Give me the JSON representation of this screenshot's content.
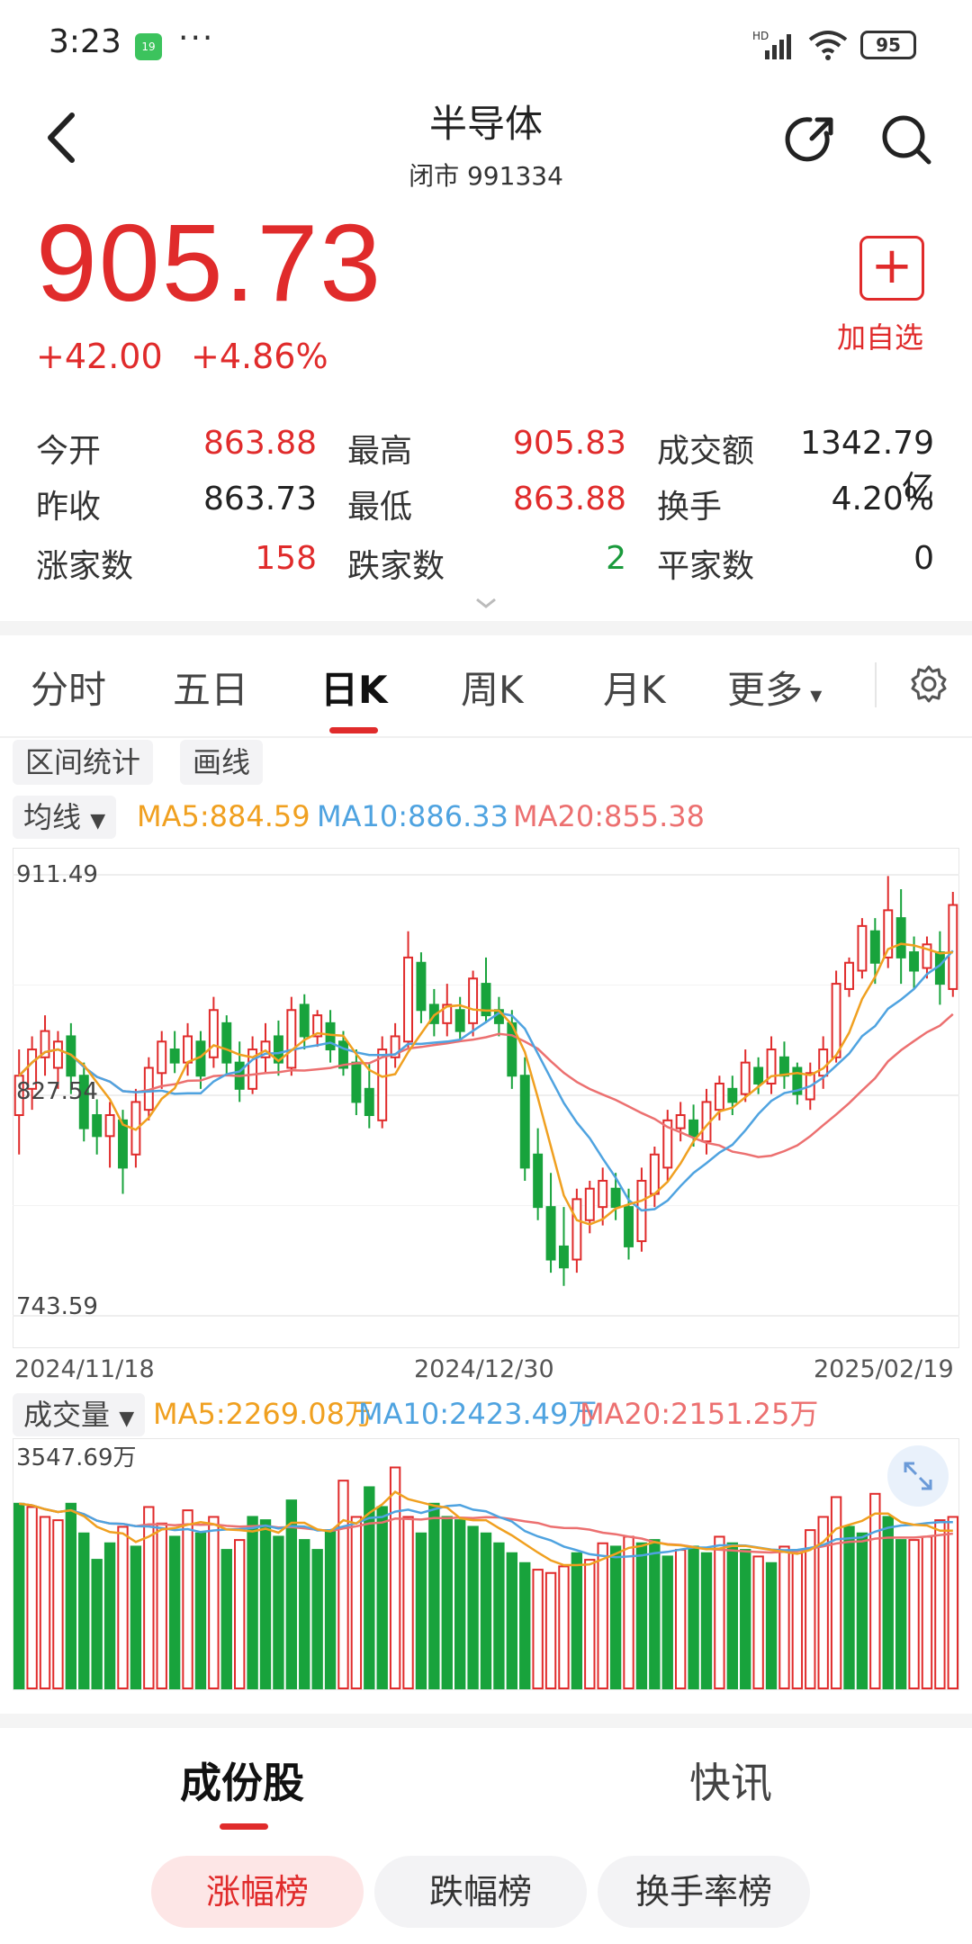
{
  "status_bar": {
    "time": "3:23",
    "badge": "19",
    "dots": "···",
    "battery": "95"
  },
  "header": {
    "title": "半导体",
    "subtitle": "闭市 991334"
  },
  "quote": {
    "price": "905.73",
    "change": "+42.00",
    "change_pct": "+4.86%",
    "add_watch": "加自选"
  },
  "stats": [
    {
      "label": "今开",
      "value": "863.88",
      "color": "red"
    },
    {
      "label": "最高",
      "value": "905.83",
      "color": "red"
    },
    {
      "label": "成交额",
      "value": "1342.79亿",
      "color": "black"
    },
    {
      "label": "昨收",
      "value": "863.73",
      "color": "black"
    },
    {
      "label": "最低",
      "value": "863.88",
      "color": "red"
    },
    {
      "label": "换手",
      "value": "4.20%",
      "color": "black"
    },
    {
      "label": "涨家数",
      "value": "158",
      "color": "red"
    },
    {
      "label": "跌家数",
      "value": "2",
      "color": "green"
    },
    {
      "label": "平家数",
      "value": "0",
      "color": "black"
    }
  ],
  "tabs": [
    "分时",
    "五日",
    "日K",
    "周K",
    "月K",
    "更多"
  ],
  "chips": [
    "区间统计",
    "画线"
  ],
  "ma": {
    "selector": "均线",
    "ma5": "MA5:884.59",
    "ma10": "MA10:886.33",
    "ma20": "MA20:855.38"
  },
  "vol": {
    "selector": "成交量",
    "ma5": "MA5:2269.08万",
    "ma10": "MA10:2423.49万",
    "ma20": "MA20:2151.25万",
    "max_label": "3547.69万"
  },
  "chart_data": {
    "type": "candlestick",
    "y_ticks": [
      "911.49",
      "827.54",
      "743.59"
    ],
    "ylim": [
      743.59,
      911.49
    ],
    "x_labels": [
      "2024/11/18",
      "2024/12/30",
      "2025/02/19"
    ],
    "colors": {
      "up": "#e02b2b",
      "down": "#18a33c",
      "ma5": "#f0a020",
      "ma10": "#4fa3e0",
      "ma20": "#ec7070"
    },
    "candles": [
      [
        820,
        835,
        805,
        845
      ],
      [
        830,
        845,
        822,
        850
      ],
      [
        842,
        852,
        835,
        858
      ],
      [
        838,
        848,
        830,
        852
      ],
      [
        850,
        835,
        828,
        855
      ],
      [
        835,
        815,
        810,
        840
      ],
      [
        820,
        812,
        805,
        826
      ],
      [
        812,
        820,
        800,
        825
      ],
      [
        818,
        800,
        790,
        822
      ],
      [
        805,
        825,
        800,
        830
      ],
      [
        822,
        838,
        818,
        842
      ],
      [
        836,
        848,
        830,
        852
      ],
      [
        845,
        840,
        836,
        852
      ],
      [
        840,
        850,
        835,
        855
      ],
      [
        848,
        835,
        830,
        852
      ],
      [
        842,
        860,
        838,
        865
      ],
      [
        855,
        840,
        835,
        858
      ],
      [
        840,
        830,
        825,
        848
      ],
      [
        830,
        845,
        828,
        850
      ],
      [
        842,
        848,
        836,
        855
      ],
      [
        850,
        840,
        835,
        856
      ],
      [
        838,
        860,
        835,
        865
      ],
      [
        862,
        850,
        845,
        866
      ],
      [
        850,
        858,
        846,
        860
      ],
      [
        855,
        845,
        840,
        860
      ],
      [
        848,
        838,
        835,
        852
      ],
      [
        840,
        825,
        820,
        845
      ],
      [
        830,
        820,
        815,
        840
      ],
      [
        818,
        845,
        815,
        850
      ],
      [
        842,
        850,
        838,
        855
      ],
      [
        848,
        880,
        845,
        890
      ],
      [
        878,
        860,
        855,
        882
      ],
      [
        862,
        855,
        850,
        868
      ],
      [
        855,
        862,
        850,
        870
      ],
      [
        860,
        852,
        848,
        865
      ],
      [
        855,
        872,
        850,
        875
      ],
      [
        870,
        858,
        855,
        880
      ],
      [
        860,
        855,
        850,
        865
      ],
      [
        855,
        835,
        830,
        860
      ],
      [
        835,
        800,
        795,
        842
      ],
      [
        805,
        785,
        780,
        815
      ],
      [
        785,
        765,
        760,
        798
      ],
      [
        770,
        762,
        755,
        785
      ],
      [
        765,
        788,
        760,
        792
      ],
      [
        780,
        792,
        775,
        795
      ],
      [
        785,
        795,
        778,
        800
      ],
      [
        792,
        785,
        780,
        798
      ],
      [
        785,
        770,
        765,
        792
      ],
      [
        772,
        795,
        768,
        800
      ],
      [
        790,
        805,
        785,
        808
      ],
      [
        800,
        818,
        795,
        822
      ],
      [
        815,
        820,
        810,
        825
      ],
      [
        818,
        812,
        808,
        824
      ],
      [
        810,
        825,
        805,
        830
      ],
      [
        822,
        832,
        818,
        835
      ],
      [
        830,
        825,
        820,
        835
      ],
      [
        828,
        840,
        825,
        845
      ],
      [
        838,
        832,
        828,
        842
      ],
      [
        832,
        845,
        828,
        850
      ],
      [
        842,
        835,
        830,
        848
      ],
      [
        838,
        828,
        824,
        840
      ],
      [
        826,
        836,
        822,
        840
      ],
      [
        835,
        845,
        830,
        850
      ],
      [
        842,
        870,
        840,
        875
      ],
      [
        868,
        878,
        865,
        880
      ],
      [
        875,
        892,
        872,
        895
      ],
      [
        890,
        878,
        870,
        895
      ],
      [
        880,
        898,
        876,
        911
      ],
      [
        895,
        880,
        870,
        906
      ],
      [
        882,
        875,
        868,
        888
      ],
      [
        876,
        885,
        872,
        888
      ],
      [
        882,
        870,
        862,
        890
      ],
      [
        868,
        900,
        865,
        905
      ]
    ],
    "volume_max": 3547.69,
    "volume_unit": "万",
    "volumes": [
      [
        2800,
        "d"
      ],
      [
        2750,
        "u"
      ],
      [
        2600,
        "u"
      ],
      [
        2550,
        "u"
      ],
      [
        2800,
        "d"
      ],
      [
        2350,
        "d"
      ],
      [
        1950,
        "d"
      ],
      [
        2200,
        "d"
      ],
      [
        2450,
        "u"
      ],
      [
        2150,
        "d"
      ],
      [
        2750,
        "u"
      ],
      [
        2500,
        "u"
      ],
      [
        2300,
        "d"
      ],
      [
        2700,
        "u"
      ],
      [
        2350,
        "d"
      ],
      [
        2600,
        "u"
      ],
      [
        2100,
        "d"
      ],
      [
        2250,
        "u"
      ],
      [
        2600,
        "d"
      ],
      [
        2550,
        "d"
      ],
      [
        2300,
        "d"
      ],
      [
        2850,
        "d"
      ],
      [
        2250,
        "d"
      ],
      [
        2100,
        "d"
      ],
      [
        2400,
        "d"
      ],
      [
        3150,
        "u"
      ],
      [
        2600,
        "u"
      ],
      [
        3050,
        "d"
      ],
      [
        2750,
        "d"
      ],
      [
        3350,
        "u"
      ],
      [
        2600,
        "u"
      ],
      [
        2350,
        "d"
      ],
      [
        2800,
        "d"
      ],
      [
        2600,
        "d"
      ],
      [
        2550,
        "d"
      ],
      [
        2450,
        "d"
      ],
      [
        2350,
        "d"
      ],
      [
        2200,
        "d"
      ],
      [
        2050,
        "d"
      ],
      [
        1900,
        "d"
      ],
      [
        1800,
        "u"
      ],
      [
        1750,
        "u"
      ],
      [
        1850,
        "u"
      ],
      [
        2050,
        "d"
      ],
      [
        1950,
        "u"
      ],
      [
        2200,
        "u"
      ],
      [
        2150,
        "d"
      ],
      [
        2300,
        "u"
      ],
      [
        2200,
        "d"
      ],
      [
        2250,
        "d"
      ],
      [
        2000,
        "d"
      ],
      [
        2100,
        "u"
      ],
      [
        2150,
        "d"
      ],
      [
        2050,
        "d"
      ],
      [
        2300,
        "u"
      ],
      [
        2200,
        "d"
      ],
      [
        2100,
        "d"
      ],
      [
        2000,
        "u"
      ],
      [
        1900,
        "d"
      ],
      [
        2150,
        "u"
      ],
      [
        2050,
        "u"
      ],
      [
        2400,
        "u"
      ],
      [
        2600,
        "u"
      ],
      [
        2900,
        "u"
      ],
      [
        2450,
        "d"
      ],
      [
        2350,
        "d"
      ],
      [
        2950,
        "u"
      ],
      [
        2600,
        "d"
      ],
      [
        2250,
        "d"
      ],
      [
        2250,
        "u"
      ],
      [
        2300,
        "u"
      ],
      [
        2550,
        "u"
      ],
      [
        2600,
        "u"
      ]
    ]
  },
  "bottom": {
    "tab1": "成份股",
    "tab2": "快讯",
    "pills": [
      "涨幅榜",
      "跌幅榜",
      "换手率榜"
    ]
  }
}
